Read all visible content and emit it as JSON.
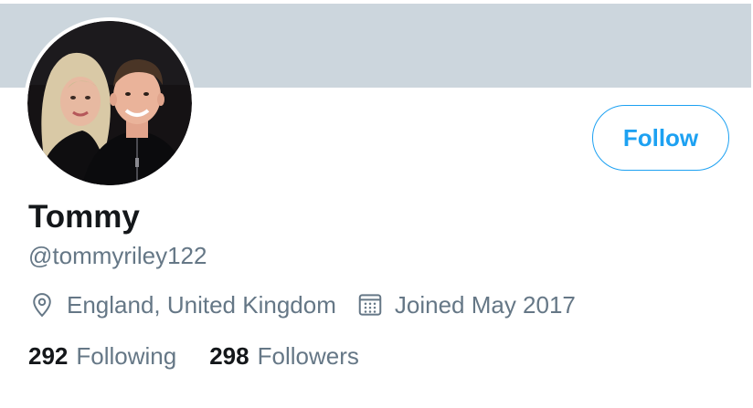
{
  "profile": {
    "display_name": "Tommy",
    "handle": "@tommyriley122",
    "location": "England, United Kingdom",
    "joined": "Joined May 2017",
    "avatar_icon": "profile-photo"
  },
  "actions": {
    "follow_label": "Follow"
  },
  "stats": {
    "following_count": "292",
    "following_label": "Following",
    "followers_count": "298",
    "followers_label": "Followers"
  },
  "icons": {
    "location": "location-pin-icon",
    "joined": "calendar-icon"
  },
  "colors": {
    "banner": "#ccd6dd",
    "accent": "#1da1f2",
    "primary_text": "#14171a",
    "secondary_text": "#657786"
  }
}
